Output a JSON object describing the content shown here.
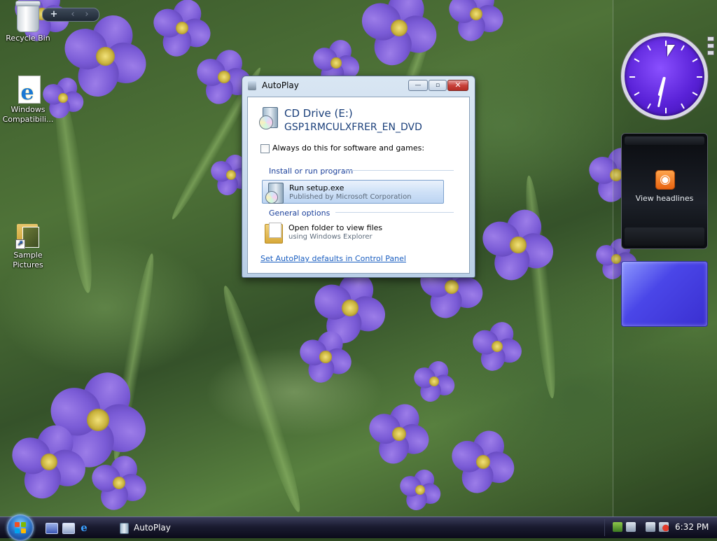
{
  "desktop": {
    "icons": [
      {
        "label": "Recycle Bin",
        "icon": "recycle-bin-icon"
      },
      {
        "label": "Windows Compatibili...",
        "icon": "internet-explorer-icon"
      },
      {
        "label": "Sample Pictures",
        "icon": "folder-shortcut-icon"
      }
    ]
  },
  "sidebar": {
    "add_gadget": "+",
    "prev": "‹",
    "next": "›",
    "feed_gadget_label": "View headlines",
    "clock_time": "6:32"
  },
  "autoplay_window": {
    "title": "AutoPlay",
    "minimize": "—",
    "maximize": "▫",
    "close": "✕",
    "drive_name": "CD Drive (E:)",
    "drive_label": "GSP1RMCULXFRER_EN_DVD",
    "always_checkbox_label": "Always do this for software and games:",
    "always_checked": false,
    "groups": [
      {
        "heading": "Install or run program",
        "options": [
          {
            "title": "Run setup.exe",
            "subtitle": "Published by Microsoft Corporation",
            "icon": "cd-setup-icon",
            "highlighted": true
          }
        ]
      },
      {
        "heading": "General options",
        "options": [
          {
            "title": "Open folder to view files",
            "subtitle": "using Windows Explorer",
            "icon": "folder-icon",
            "highlighted": false
          }
        ]
      }
    ],
    "control_panel_link": "Set AutoPlay defaults in Control Panel"
  },
  "taskbar": {
    "start_icon": "windows-start-orb",
    "quick_launch": [
      "show-desktop-icon",
      "switch-windows-icon",
      "internet-explorer-icon"
    ],
    "tasks": [
      {
        "label": "AutoPlay",
        "icon": "autoplay-icon"
      }
    ],
    "tray_icons": [
      "network-icon",
      "sidebar-icon",
      "network-warning-icon",
      "volume-muted-icon"
    ],
    "clock": "6:32 PM"
  },
  "colors": {
    "accent": "#1a3f7a",
    "link": "#1a5ec0",
    "clock_face": "#5a22d8",
    "rss": "#e8610e"
  }
}
